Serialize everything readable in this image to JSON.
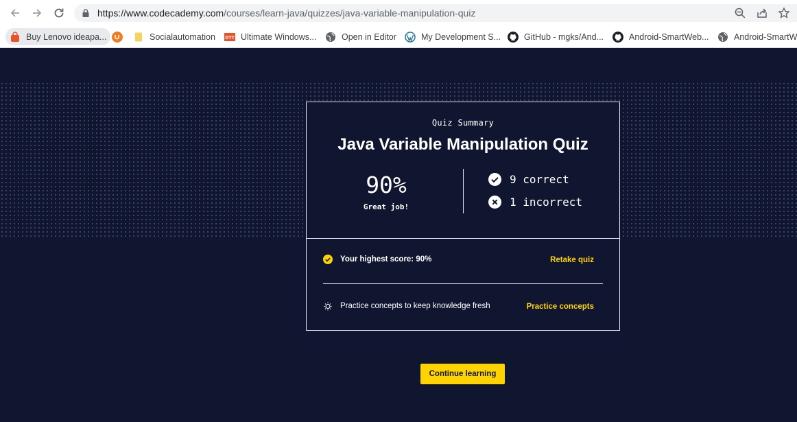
{
  "browser": {
    "url_host": "https://www.codecademy.com",
    "url_path": "/courses/learn-java/quizzes/java-variable-manipulation-quiz",
    "nav_icons": [
      "back-arrow-icon",
      "forward-arrow-icon",
      "reload-icon"
    ],
    "omnibox_icons": [
      "zoom-icon",
      "share-icon",
      "star-icon"
    ]
  },
  "bookmarks": [
    {
      "label": "Buy Lenovo ideapa...",
      "icon": "shopping-bag-icon",
      "color": "#e8532b"
    },
    {
      "label": "",
      "icon": "upwork-icon",
      "color": "#f47a20"
    },
    {
      "label": "Socialautomation",
      "icon": "folder-icon",
      "color": "#f6d35a"
    },
    {
      "label": "Ultimate Windows...",
      "icon": "ott-icon",
      "color": "#e8532b"
    },
    {
      "label": "Open in Editor",
      "icon": "globe-icon",
      "color": "#5f6368"
    },
    {
      "label": "My Development S...",
      "icon": "wordpress-icon",
      "color": "#21759b"
    },
    {
      "label": "GitHub - mgks/And...",
      "icon": "github-icon",
      "color": "#1b1f23"
    },
    {
      "label": "Android-SmartWeb...",
      "icon": "github-icon",
      "color": "#1b1f23"
    },
    {
      "label": "Android-SmartW",
      "icon": "globe-icon",
      "color": "#5f6368"
    }
  ],
  "quiz": {
    "eyebrow": "Quiz Summary",
    "title": "Java Variable Manipulation Quiz",
    "score": "90%",
    "score_message": "Great job!",
    "correct_text": "9 correct",
    "incorrect_text": "1 incorrect",
    "highest_score_text": "Your highest score: 90%",
    "retake_label": "Retake quiz",
    "practice_text": "Practice concepts to keep knowledge fresh",
    "practice_label": "Practice concepts"
  },
  "continue_label": "Continue learning",
  "colors": {
    "background": "#10162f",
    "accent": "#ffd300",
    "text": "#ffffff"
  }
}
